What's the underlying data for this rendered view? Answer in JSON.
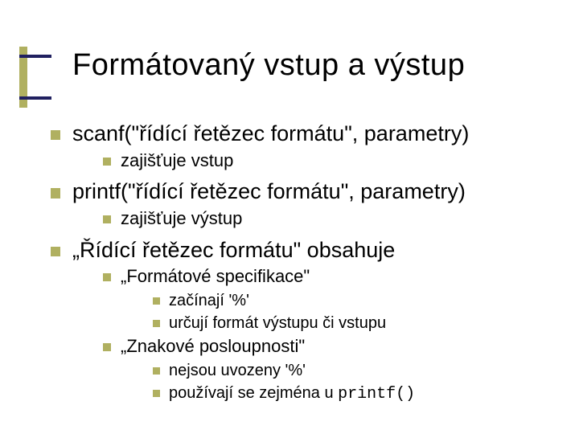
{
  "title": "Formátovaný vstup a výstup",
  "items": {
    "i1": "scanf(\"řídící řetězec formátu\", parametry)",
    "i1a": "zajišťuje vstup",
    "i2": "printf(\"řídící řetězec formátu\", parametry)",
    "i2a": "zajišťuje výstup",
    "i3": "„Řídící řetězec formátu\" obsahuje",
    "i3a": "„Formátové specifikace\"",
    "i3a1": "začínají '%'",
    "i3a2": "určují formát výstupu či vstupu",
    "i3b": "„Znakové posloupnosti\"",
    "i3b1": "nejsou uvozeny '%'",
    "i3b2_pre": "používají se zejména u ",
    "i3b2_code": "printf()"
  }
}
